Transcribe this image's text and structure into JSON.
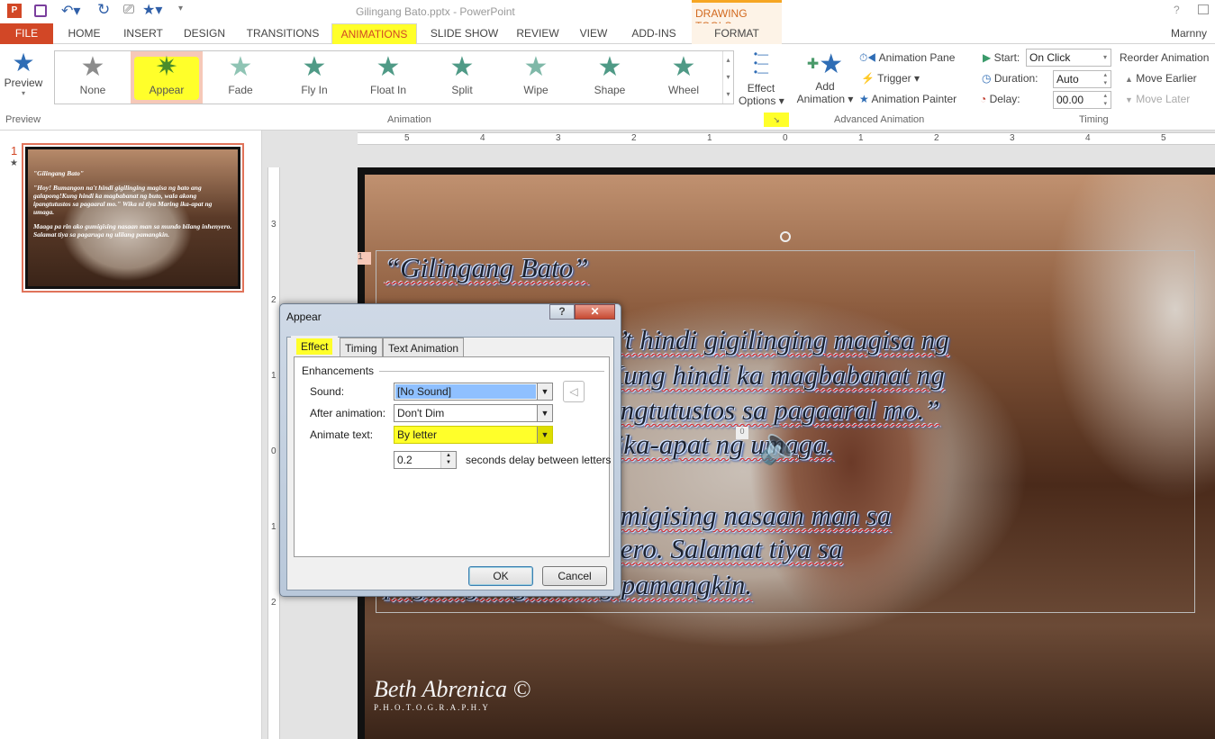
{
  "window": {
    "title": "Gilingang Bato.pptx - PowerPoint",
    "context_tab": "DRAWING TOOLS",
    "help": "?",
    "user": "Marnny"
  },
  "tabs": [
    {
      "label": "FILE"
    },
    {
      "label": "HOME"
    },
    {
      "label": "INSERT"
    },
    {
      "label": "DESIGN"
    },
    {
      "label": "TRANSITIONS"
    },
    {
      "label": "ANIMATIONS"
    },
    {
      "label": "SLIDE SHOW"
    },
    {
      "label": "REVIEW"
    },
    {
      "label": "VIEW"
    },
    {
      "label": "ADD-INS"
    },
    {
      "label": "FORMAT"
    }
  ],
  "ribbon": {
    "preview": {
      "label": "Preview",
      "group": "Preview"
    },
    "animation_group": "Animation",
    "gallery": [
      {
        "label": "None",
        "color": "#8c8c8c"
      },
      {
        "label": "Appear",
        "color": "#4a8c2a"
      },
      {
        "label": "Fade",
        "color": "#8fc4b4"
      },
      {
        "label": "Fly In",
        "color": "#4f9a86"
      },
      {
        "label": "Float In",
        "color": "#4f9a86"
      },
      {
        "label": "Split",
        "color": "#4f9a86"
      },
      {
        "label": "Wipe",
        "color": "#7fb8a8"
      },
      {
        "label": "Shape",
        "color": "#4f9a86"
      },
      {
        "label": "Wheel",
        "color": "#4f9a86"
      }
    ],
    "effect_options": {
      "line1": "Effect",
      "line2": "Options"
    },
    "advanced": {
      "group": "Advanced Animation",
      "add_line1": "Add",
      "add_line2": "Animation",
      "pane": "Animation Pane",
      "trigger": "Trigger",
      "painter": "Animation Painter"
    },
    "timing": {
      "group": "Timing",
      "start_label": "Start:",
      "start_value": "On Click",
      "duration_label": "Duration:",
      "duration_value": "Auto",
      "delay_label": "Delay:",
      "delay_value": "00.00",
      "reorder": "Reorder Animation",
      "earlier": "Move Earlier",
      "later": "Move Later"
    }
  },
  "thumbnail": {
    "number": "1",
    "star": "★",
    "title": "\"Gilingang Bato\"",
    "body": "\"Hoy! Bumangon na't hindi gigilinging magisa ng bato ang galapong!Kung hindi ka magbabanat ng buto, wala akong ipangtutustos sa pagaaral mo.\" Wika ni tiya Maring ika-apat ng umaga.",
    "body2": "Maaga pa rin ako gumigising nasaan man sa mundo bilang inhenyero. Salamat tiya sa pagaruga ng ulilang pamangkin."
  },
  "ruler": {
    "h": [
      "5",
      "4",
      "3",
      "2",
      "1",
      "0",
      "1",
      "2",
      "3",
      "4",
      "5"
    ],
    "v": [
      "3",
      "2",
      "1",
      "0",
      "1",
      "2"
    ]
  },
  "slide": {
    "anim_tag": "1",
    "sound_tag": "0",
    "lines": [
      "“Gilingang Bato”",
      "“Hoy! Bumangon na’t hindi gigilinging magisa ng",
      "bato ang galapong!Kung hindi ka magbabanat ng",
      "buto, wala akong ipangtutustos sa pagaaral mo.”",
      "Wika ni tiya Maring ika-apat ng umaga.",
      "Maaga pa rin ako gumigising nasaan man sa",
      "mundo bilang inhenyero. Salamat tiya sa",
      "pagaruga ng ulilang pamangkin."
    ],
    "watermark": "Beth Abrenica ©",
    "watermark_sub": "P.H.O.T.O.G.R.A.P.H.Y"
  },
  "dialog": {
    "title": "Appear",
    "help": "?",
    "close": "✕",
    "tabs": [
      "Effect",
      "Timing",
      "Text Animation"
    ],
    "section": "Enhancements",
    "sound_label": "Sound:",
    "sound_value": "[No Sound]",
    "after_label": "After animation:",
    "after_value": "Don't Dim",
    "animate_label": "Animate text:",
    "animate_value": "By letter",
    "delay_value": "0.2",
    "delay_label": "seconds delay between letters",
    "ok": "OK",
    "cancel": "Cancel"
  }
}
